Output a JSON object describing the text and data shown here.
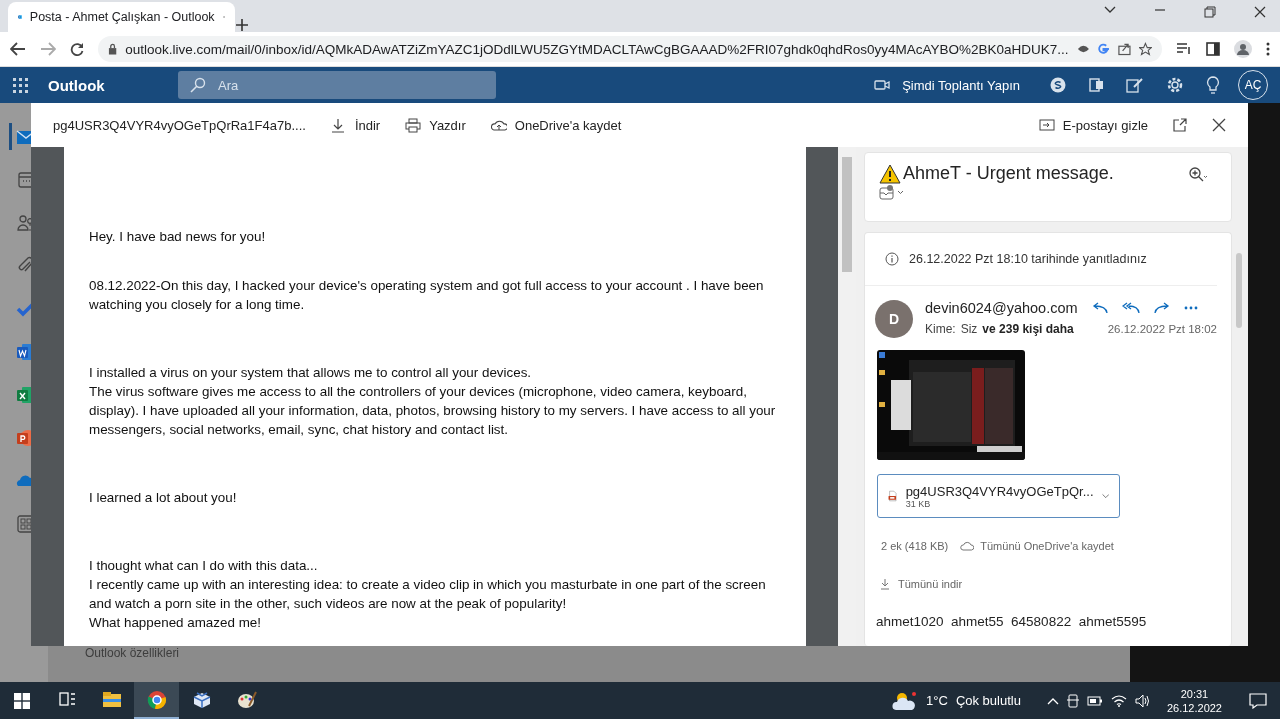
{
  "browser": {
    "tab_title": "Posta - Ahmet Çalışkan - Outlook",
    "url": "outlook.live.com/mail/0/inbox/id/AQMkADAwATZiZmYAZC1jODdlLWU5ZGYtMDACLTAwCgBGAAAD%2FRI07ghdk0qhdRos0yy4MAcAYBO%2BK0aHDUK7..."
  },
  "outlook": {
    "app_name": "Outlook",
    "search_placeholder": "Ara",
    "meet_now": "Şimdi Toplantı Yapın",
    "avatar_initials": "AÇ",
    "behind_text": "Outlook özellikleri",
    "rail": [
      {
        "kind": "mail",
        "selected": true
      },
      {
        "kind": "calendar",
        "selected": false
      },
      {
        "kind": "people",
        "selected": false
      },
      {
        "kind": "attachment",
        "selected": false
      },
      {
        "kind": "todo",
        "selected": false
      },
      {
        "kind": "word",
        "selected": false
      },
      {
        "kind": "excel",
        "selected": false
      },
      {
        "kind": "powerpoint",
        "selected": false
      },
      {
        "kind": "onedrive",
        "selected": false
      },
      {
        "kind": "apps",
        "selected": false
      }
    ]
  },
  "viewer": {
    "file_name": "pg4USR3Q4VYR4vyOGeTpQrRa1F4a7b....",
    "hide_email": "E-postayı gizle",
    "actions": [
      {
        "kind": "download",
        "label": "İndir"
      },
      {
        "kind": "print",
        "label": "Yazdır"
      },
      {
        "kind": "onedrive",
        "label": "OneDrive'a kaydet"
      }
    ],
    "body": [
      [
        "Hey. I have bad news for you!"
      ],
      [
        "08.12.2022-On this day, I hacked your device's operating system and got full access to your account . I have been watching you closely for a long time."
      ],
      [
        "I installed a virus on your system that allows me to control all your devices.",
        "The virus software gives me access to all the controllers of your devices (microphone, video camera, keyboard, display). I have uploaded all your information, data, photos, browsing history to my servers. I have access to all your messengers, social networks, email, sync, chat history and contact list."
      ],
      [
        "I learned a lot about you!"
      ],
      [
        "I thought what can I do with this data...",
        "I recently came up with an interesting idea: to create a video clip in which you masturbate in one part of the screen and watch a porn site in the other, such videos are now at the peak of popularity!",
        "What happened amazed me!"
      ]
    ]
  },
  "message": {
    "subject": "AhmeT - Urgent message.",
    "replied_note": "26.12.2022 Pzt 18:10 tarihinde yanıtladınız",
    "sender_initial": "D",
    "sender": "devin6024@yahoo.com",
    "to_label": "Kime:",
    "to": "Siz",
    "others": "ve 239 kişi daha",
    "date": "26.12.2022 Pzt 18:02",
    "attachment": {
      "name": "pg4USR3Q4VYR4vyOGeTpQr...",
      "size": "31 KB"
    },
    "attachment_summary": "2 ek (418 KB)",
    "save_all": "Tümünü OneDrive'a kaydet",
    "download_all": "Tümünü indir",
    "body_start": "ahmet1020  ahmet55  64580822  ahmet5595"
  },
  "taskbar": {
    "apps": [
      {
        "kind": "taskview",
        "selected": false
      },
      {
        "kind": "explorer",
        "selected": false
      },
      {
        "kind": "chrome",
        "selected": true
      },
      {
        "kind": "box",
        "selected": false
      },
      {
        "kind": "paint",
        "selected": false
      }
    ],
    "temperature": "1°C",
    "condition": "Çok bulutlu",
    "time": "20:31",
    "date": "26.12.2022"
  }
}
